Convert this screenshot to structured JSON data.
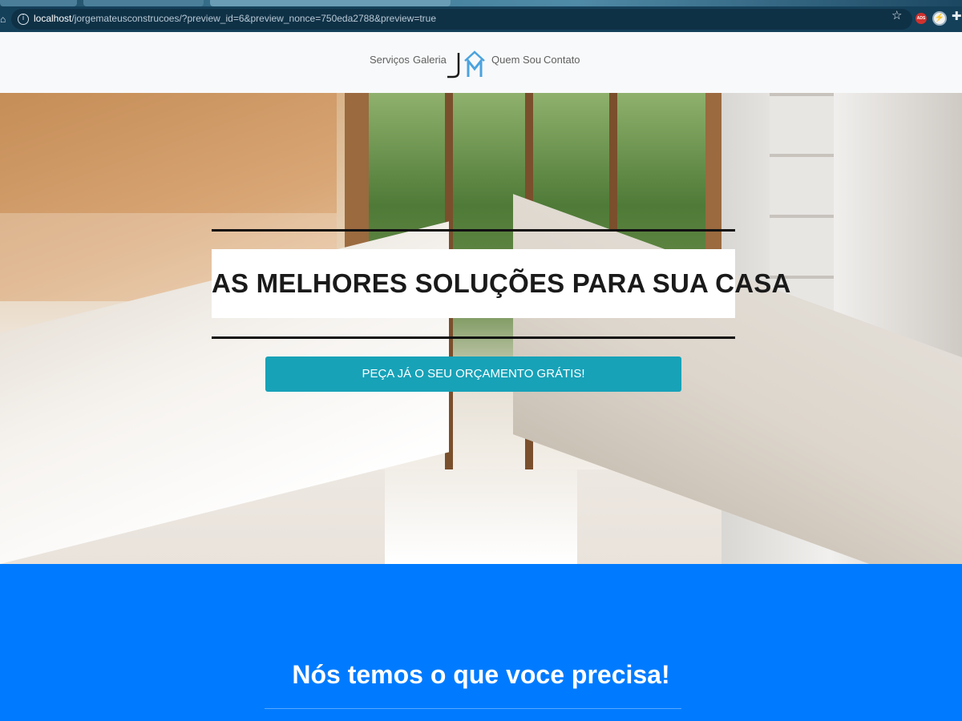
{
  "browser": {
    "url_host": "localhost",
    "url_path": "/jorgemateusconstrucoes/?preview_id=6&preview_nonce=750eda2788&preview=true",
    "info_icon": "info-icon",
    "info_glyph": "i",
    "star_icon": "star-icon",
    "ext_ads_label": "ADS",
    "extension_icons": [
      "ads-extension-icon",
      "circle-extension-icon",
      "puzzle-icon"
    ]
  },
  "navbar": {
    "links": [
      "Serviços",
      "Galeria",
      "Quem Sou",
      "Contato"
    ],
    "logo_letters": "JM",
    "logo_colors": {
      "j": "#1a1a1a",
      "m": "#4aa3df"
    }
  },
  "hero": {
    "headline": "AS MELHORES SOLUÇÕES PARA SUA CASA",
    "cta_label": "PEÇA JÁ O SEU ORÇAMENTO GRÁTIS!",
    "cta_color": "#17a2b8"
  },
  "section": {
    "title": "Nós temos o que voce precisa!",
    "background": "#007bff"
  }
}
